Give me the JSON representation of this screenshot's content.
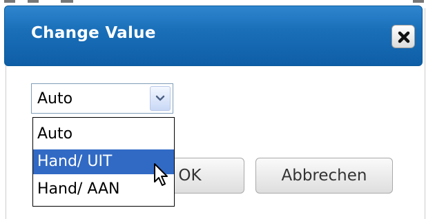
{
  "dialog": {
    "title": "Change Value",
    "close_icon": "close-x-icon"
  },
  "select": {
    "value": "Auto",
    "options": [
      "Auto",
      "Hand/ UIT",
      "Hand/ AAN"
    ],
    "highlighted_option": "Hand/ UIT"
  },
  "buttons": {
    "ok_label": "OK",
    "cancel_label": "Abbrechen"
  },
  "colors": {
    "titlebar": "#1a6fb9",
    "selected_option": "#316ac5"
  }
}
